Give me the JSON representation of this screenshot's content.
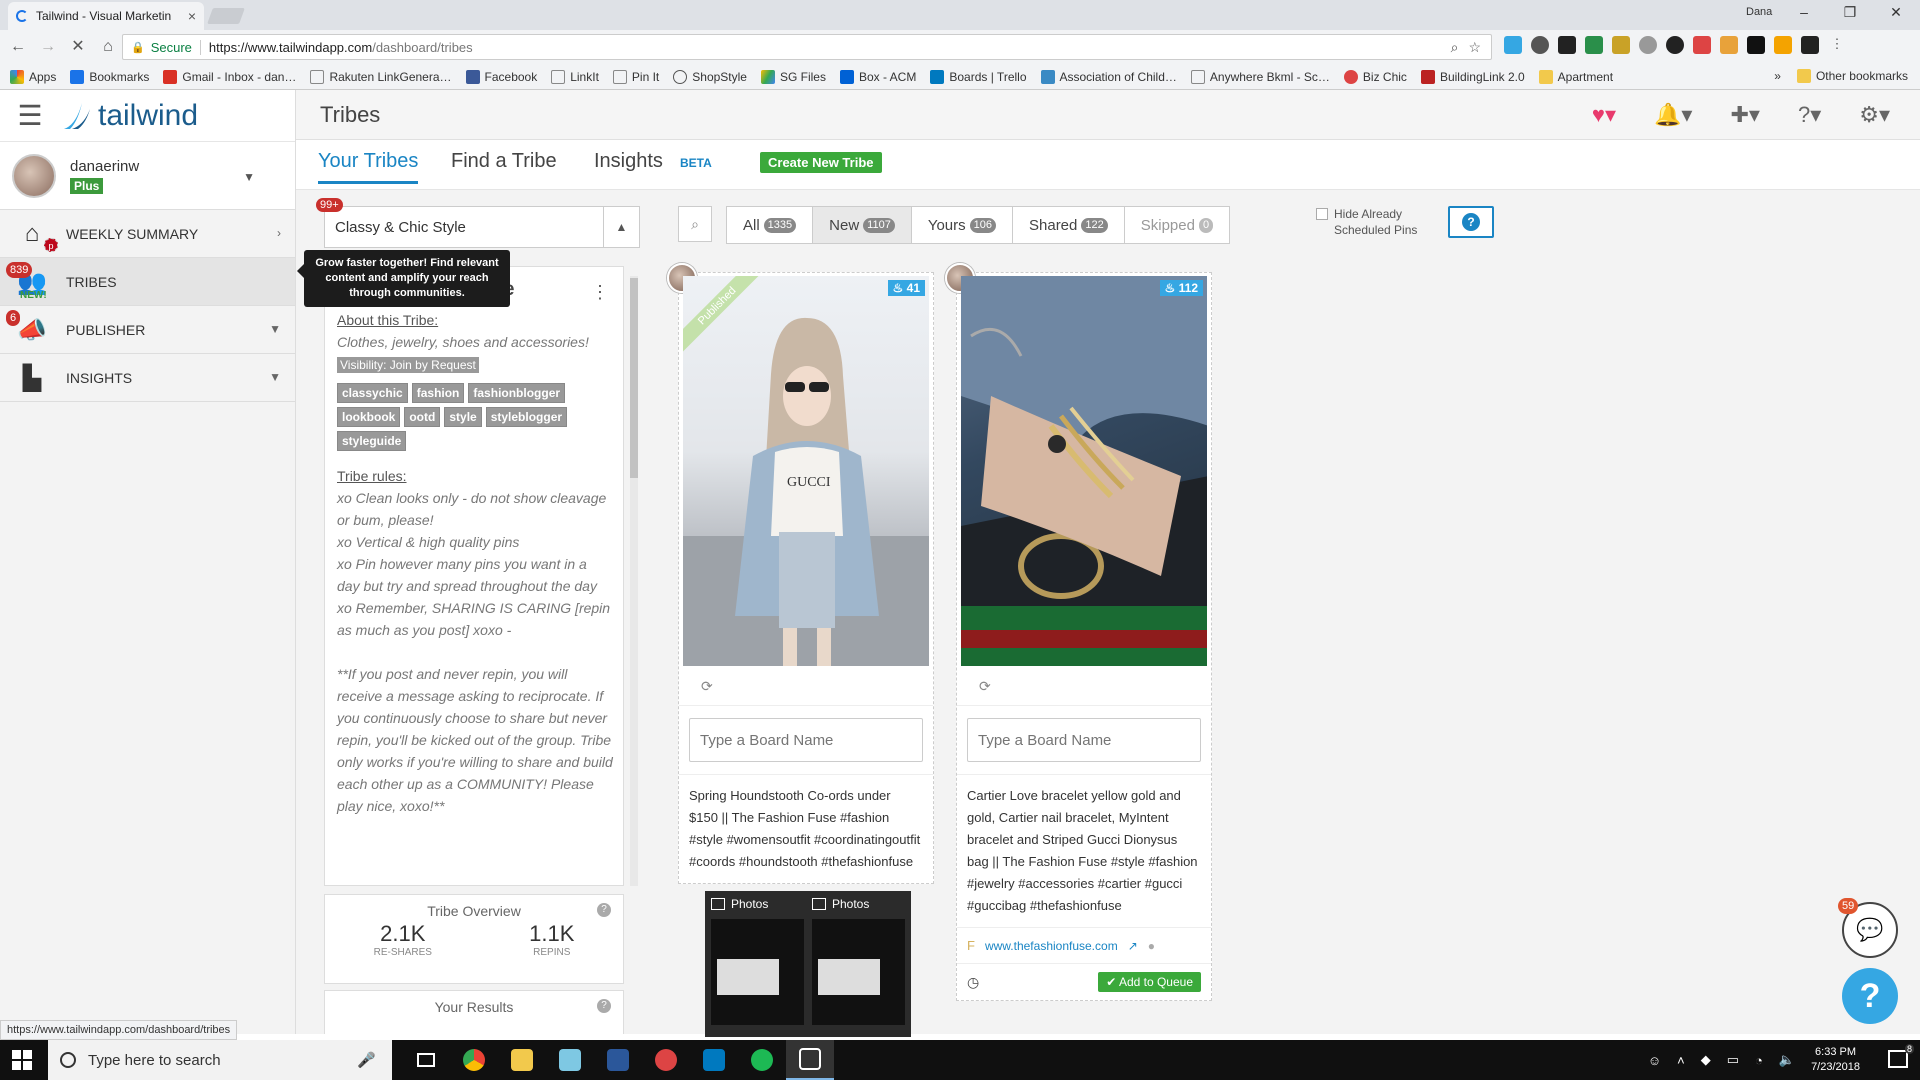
{
  "browser": {
    "tab_title": "Tailwind - Visual Marketin",
    "profile_name": "Dana",
    "secure_label": "Secure",
    "url_host": "https://www.tailwindapp.com",
    "url_path": "/dashboard/tribes",
    "bookmarks": [
      "Apps",
      "Bookmarks",
      "Gmail - Inbox - dan…",
      "Rakuten LinkGenera…",
      "Facebook",
      "LinkIt",
      "Pin It",
      "ShopStyle",
      "SG Files",
      "Box - ACM",
      "Boards | Trello",
      "Association of Child…",
      "Anywhere Bkml - Sc…",
      "Biz Chic",
      "BuildingLink 2.0",
      "Apartment"
    ],
    "more_bookmarks": "»",
    "other_bookmarks": "Other bookmarks",
    "status_url": "https://www.tailwindapp.com/dashboard/tribes"
  },
  "sidebar": {
    "brand": "tailwind",
    "user_name": "danaerinw",
    "plan": "Plus",
    "items": [
      {
        "label": "WEEKLY SUMMARY",
        "badge": "",
        "icon": "home-icon"
      },
      {
        "label": "TRIBES",
        "badge": "839",
        "new": "NEW!",
        "icon": "tribes-icon"
      },
      {
        "label": "PUBLISHER",
        "badge": "6",
        "icon": "megaphone-icon"
      },
      {
        "label": "INSIGHTS",
        "badge": "",
        "icon": "bar-chart-icon"
      }
    ]
  },
  "header": {
    "title": "Tribes"
  },
  "tabs": {
    "your_tribes": "Your Tribes",
    "find_tribe": "Find a Tribe",
    "insights": "Insights",
    "beta": "BETA",
    "create": "Create New Tribe"
  },
  "tribe": {
    "badge": "99+",
    "selected": "Classy & Chic Style",
    "name": "Classy & Chic Style",
    "tooltip": "Grow faster together! Find relevant content and amplify your reach through communities.",
    "about_heading": "About this Tribe:",
    "about_text": "Clothes, jewelry, shoes and accessories!",
    "visibility": "Visibility: Join by Request",
    "tags": [
      "classychic",
      "fashion",
      "fashionblogger",
      "lookbook",
      "ootd",
      "style",
      "styleblogger",
      "styleguide"
    ],
    "rules_heading": "Tribe rules:",
    "rules": [
      "xo Clean looks only - do not show cleavage or bum, please!",
      "xo Vertical & high quality pins",
      "xo Pin however many pins you want in a day but try and spread throughout the day",
      "xo Remember, SHARING IS CARING [repin as much as you post] xoxo -"
    ],
    "rules_note": "**If you post and never repin, you will receive a message asking to reciprocate. If you continuously choose to share but never repin, you'll be kicked out of the group. Tribe only works if you're willing to share and build each other up as a COMMUNITY! Please play nice, xoxo!**",
    "overview_title": "Tribe Overview",
    "reshares": "2.1K",
    "reshares_label": "RE-SHARES",
    "repins": "1.1K",
    "repins_label": "REPINS",
    "results_title": "Your Results"
  },
  "filters": [
    {
      "label": "All",
      "count": "1335"
    },
    {
      "label": "New",
      "count": "1107"
    },
    {
      "label": "Yours",
      "count": "106"
    },
    {
      "label": "Shared",
      "count": "122"
    },
    {
      "label": "Skipped",
      "count": "0"
    }
  ],
  "hide_scheduled": "Hide Already Scheduled Pins",
  "pins": [
    {
      "repins": "41",
      "published": "Published",
      "board_placeholder": "Type a Board Name",
      "description": "Spring Houndstooth Co-ords under $150 || The Fashion Fuse #fashion #style #womensoutfit #coordinatingoutfit #coords #houndstooth #thefashionfuse"
    },
    {
      "repins": "112",
      "board_placeholder": "Type a Board Name",
      "description": "Cartier Love bracelet yellow gold and gold, Cartier nail bracelet, MyIntent bracelet and Striped Gucci Dionysus bag || The Fashion Fuse #style #fashion #jewelry #accessories #cartier #gucci #guccibag #thefashionfuse",
      "source": "www.thefashionfuse.com",
      "add_label": "Add to Queue"
    }
  ],
  "photos_popup": [
    "Photos",
    "Photos"
  ],
  "chat": {
    "count": "59"
  },
  "taskbar": {
    "search_placeholder": "Type here to search",
    "time": "6:33 PM",
    "date": "7/23/2018",
    "notifications": "8"
  }
}
